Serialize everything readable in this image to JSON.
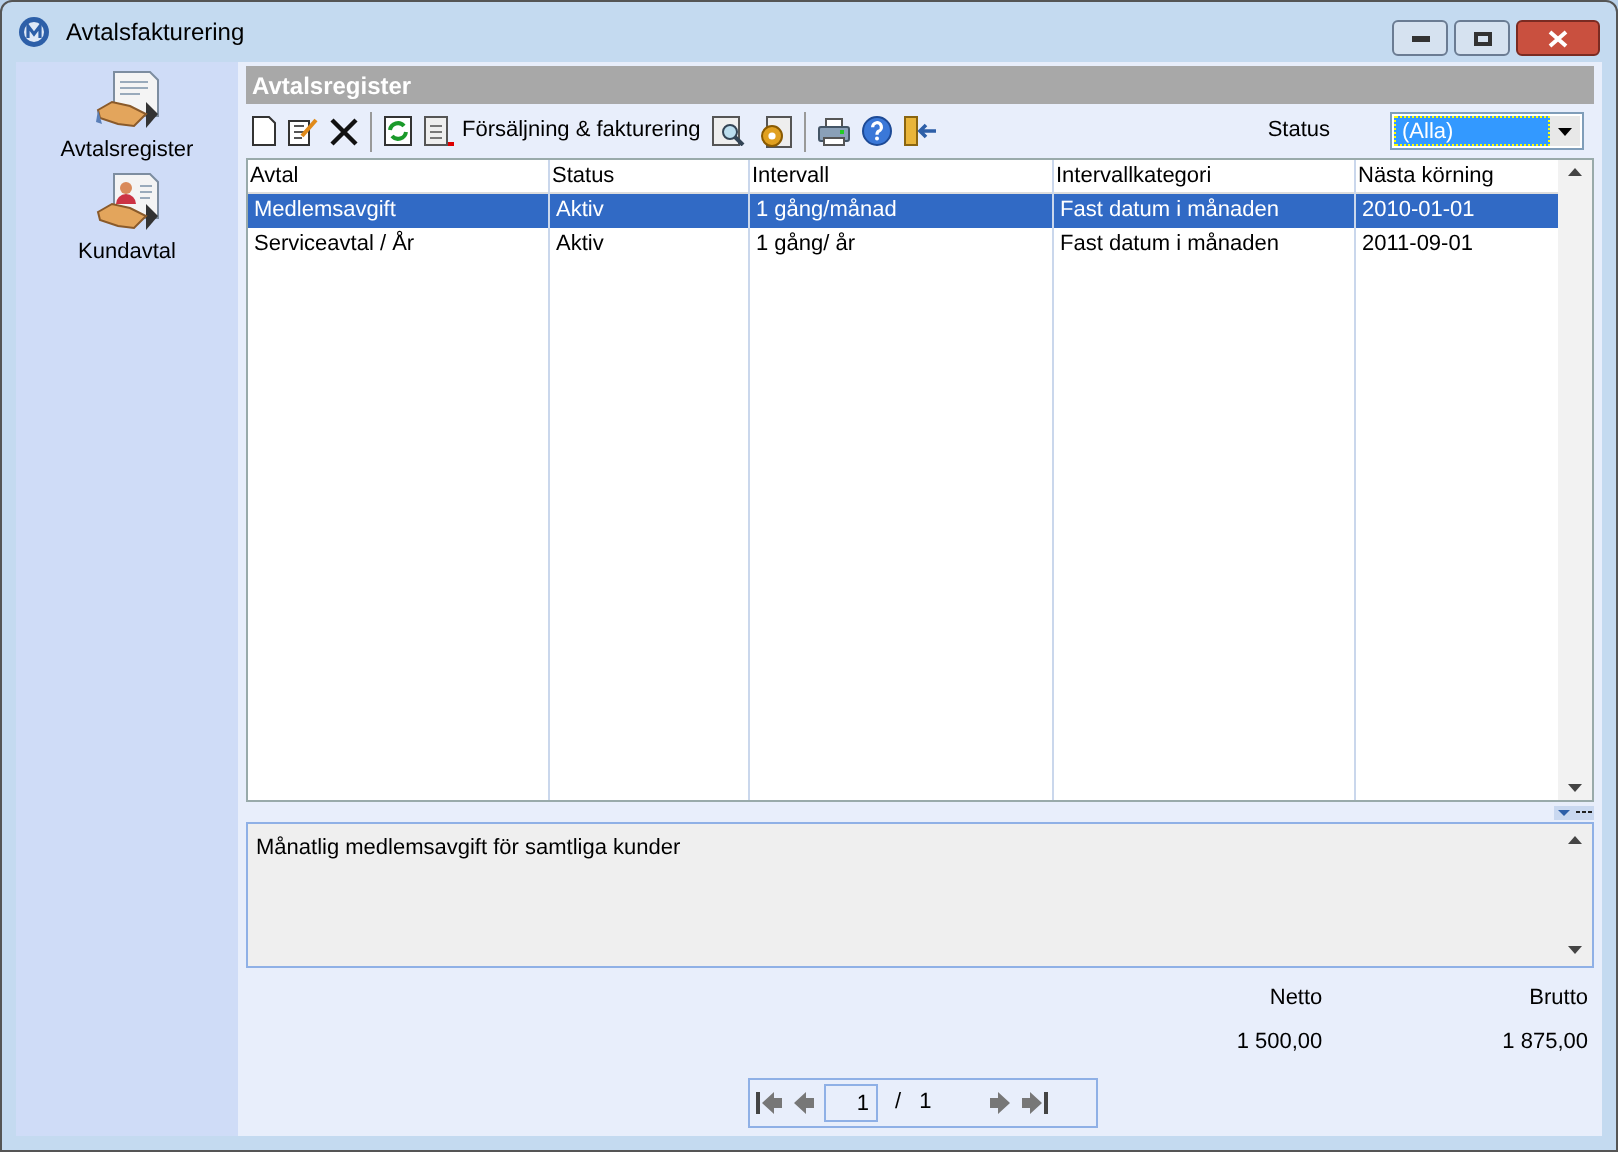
{
  "window": {
    "title": "Avtalsfakturering"
  },
  "sidebar": {
    "items": [
      {
        "label": "Avtalsregister"
      },
      {
        "label": "Kundavtal"
      }
    ]
  },
  "panel": {
    "title": "Avtalsregister"
  },
  "toolbar": {
    "sales_button": "Försäljning & fakturering",
    "status_label": "Status",
    "status_value": "(Alla)"
  },
  "table": {
    "columns": [
      "Avtal",
      "Status",
      "Intervall",
      "Intervallkategori",
      "Nästa körning"
    ],
    "rows": [
      {
        "cells": [
          "Medlemsavgift",
          "Aktiv",
          "1 gång/månad",
          "Fast datum i månaden",
          "2010-01-01"
        ],
        "selected": true
      },
      {
        "cells": [
          "Serviceavtal / År",
          "Aktiv",
          "1 gång/ år",
          "Fast datum i månaden",
          "2011-09-01"
        ],
        "selected": false
      }
    ]
  },
  "description": "Månatlig medlemsavgift för samtliga kunder",
  "totals": [
    {
      "label": "Netto",
      "value": "1 500,00"
    },
    {
      "label": "Brutto",
      "value": "1 875,00"
    }
  ],
  "pager": {
    "page": "1",
    "separator": "/",
    "total": "1"
  }
}
